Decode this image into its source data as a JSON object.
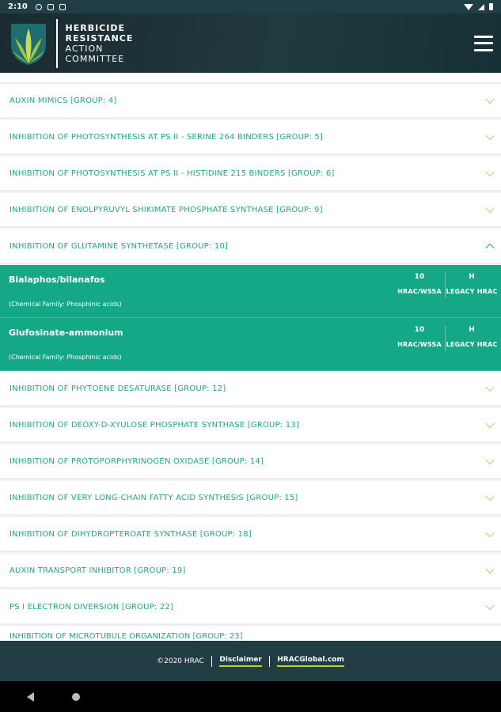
{
  "status_bar": {
    "time": "2:10"
  },
  "header": {
    "logo_lines": [
      "HERBICIDE",
      "RESISTANCE",
      "ACTION",
      "COMMITTEE"
    ]
  },
  "groups_before": [
    {
      "label": "AUXIN MIMICS [GROUP: 4]"
    },
    {
      "label": "INHIBITION OF PHOTOSYNTHESIS AT PS II - SERINE 264 BINDERS [GROUP: 5]"
    },
    {
      "label": "INHIBITION OF PHOTOSYNTHESIS AT PS II - HISTIDINE 215 BINDERS [GROUP: 6]"
    },
    {
      "label": "INHIBITION OF ENOLPYRUVYL SHIKIMATE PHOSPHATE SYNTHASE [GROUP: 9]"
    }
  ],
  "expanded_group": {
    "label": "INHIBITION OF GLUTAMINE SYNTHETASE [GROUP: 10]",
    "herbicides": [
      {
        "name": "Bialaphos/bilanafos",
        "family": "(Chemical Family: Phosphinic acids)",
        "hrac_wssa": "10",
        "legacy_hrac": "H",
        "hrac_wssa_caption": "HRAC/WSSA",
        "legacy_caption": "LEGACY HRAC"
      },
      {
        "name": "Glufosinate-ammonium",
        "family": "(Chemical Family: Phosphinic acids)",
        "hrac_wssa": "10",
        "legacy_hrac": "H",
        "hrac_wssa_caption": "HRAC/WSSA",
        "legacy_caption": "LEGACY HRAC"
      }
    ]
  },
  "groups_after": [
    {
      "label": "INHIBITION OF PHYTOENE DESATURASE [GROUP: 12]"
    },
    {
      "label": "INHIBITION OF DEOXY-D-XYULOSE PHOSPHATE SYNTHASE [GROUP: 13]"
    },
    {
      "label": "INHIBITION OF PROTOPORPHYRINOGEN OXIDASE [GROUP: 14]"
    },
    {
      "label": "INHIBITION OF VERY LONG-CHAIN FATTY ACID SYNTHESIS [GROUP: 15]"
    },
    {
      "label": "INHIBITION OF DIHYDROPTEROATE SYNTHASE [GROUP: 18]"
    },
    {
      "label": "AUXIN TRANSPORT INHIBITOR [GROUP: 19]"
    },
    {
      "label": "PS I ELECTRON DIVERSION [GROUP: 22]"
    }
  ],
  "partial_bottom_label": "INHIBITION OF MICROTUBULE ORGANIZATION [GROUP: 23]",
  "footer": {
    "copyright": "©2020 HRAC",
    "disclaimer": "Disclaimer",
    "site": "HRACGlobal.com"
  },
  "colors": {
    "accent": "#23a586",
    "expanded": "#14a887",
    "header": "#1f3f44",
    "chevron": "#b8c870"
  }
}
